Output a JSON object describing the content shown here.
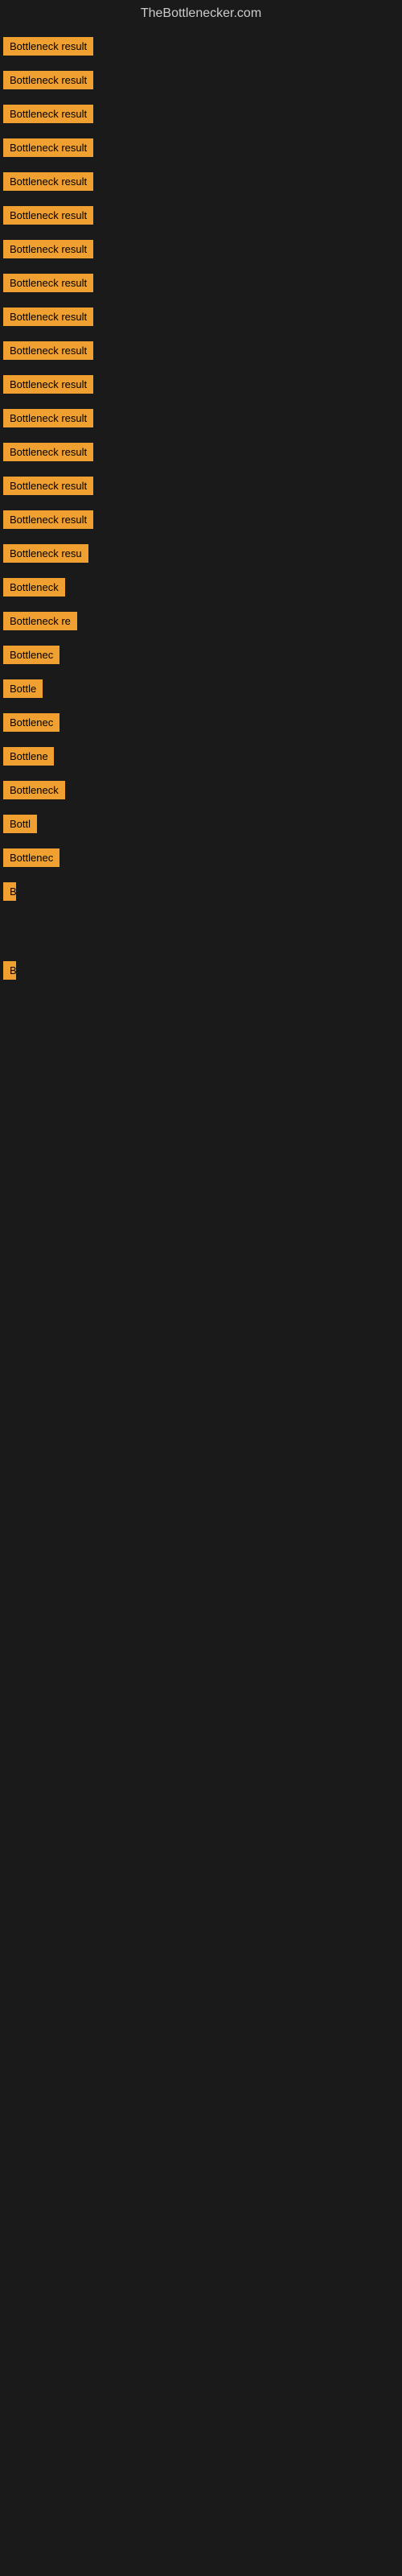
{
  "header": {
    "title": "TheBottlenecker.com"
  },
  "items": [
    {
      "label": "Bottleneck result",
      "width": 130
    },
    {
      "label": "Bottleneck result",
      "width": 130
    },
    {
      "label": "Bottleneck result",
      "width": 130
    },
    {
      "label": "Bottleneck result",
      "width": 130
    },
    {
      "label": "Bottleneck result",
      "width": 130
    },
    {
      "label": "Bottleneck result",
      "width": 130
    },
    {
      "label": "Bottleneck result",
      "width": 130
    },
    {
      "label": "Bottleneck result",
      "width": 130
    },
    {
      "label": "Bottleneck result",
      "width": 130
    },
    {
      "label": "Bottleneck result",
      "width": 130
    },
    {
      "label": "Bottleneck result",
      "width": 130
    },
    {
      "label": "Bottleneck result",
      "width": 130
    },
    {
      "label": "Bottleneck result",
      "width": 130
    },
    {
      "label": "Bottleneck result",
      "width": 130
    },
    {
      "label": "Bottleneck result",
      "width": 130
    },
    {
      "label": "Bottleneck resu",
      "width": 115
    },
    {
      "label": "Bottleneck",
      "width": 78
    },
    {
      "label": "Bottleneck re",
      "width": 100
    },
    {
      "label": "Bottlenec",
      "width": 72
    },
    {
      "label": "Bottle",
      "width": 50
    },
    {
      "label": "Bottlenec",
      "width": 72
    },
    {
      "label": "Bottlene",
      "width": 63
    },
    {
      "label": "Bottleneck",
      "width": 78
    },
    {
      "label": "Bottl",
      "width": 42
    },
    {
      "label": "Bottlenec",
      "width": 72
    },
    {
      "label": "B",
      "width": 14
    },
    {
      "label": "",
      "width": 0
    },
    {
      "label": "",
      "width": 0
    },
    {
      "label": "",
      "width": 0
    },
    {
      "label": "",
      "width": 0
    },
    {
      "label": "B",
      "width": 14
    },
    {
      "label": "",
      "width": 0
    },
    {
      "label": "",
      "width": 0
    },
    {
      "label": "",
      "width": 0
    },
    {
      "label": "",
      "width": 0
    },
    {
      "label": "",
      "width": 0
    },
    {
      "label": "",
      "width": 0
    }
  ]
}
